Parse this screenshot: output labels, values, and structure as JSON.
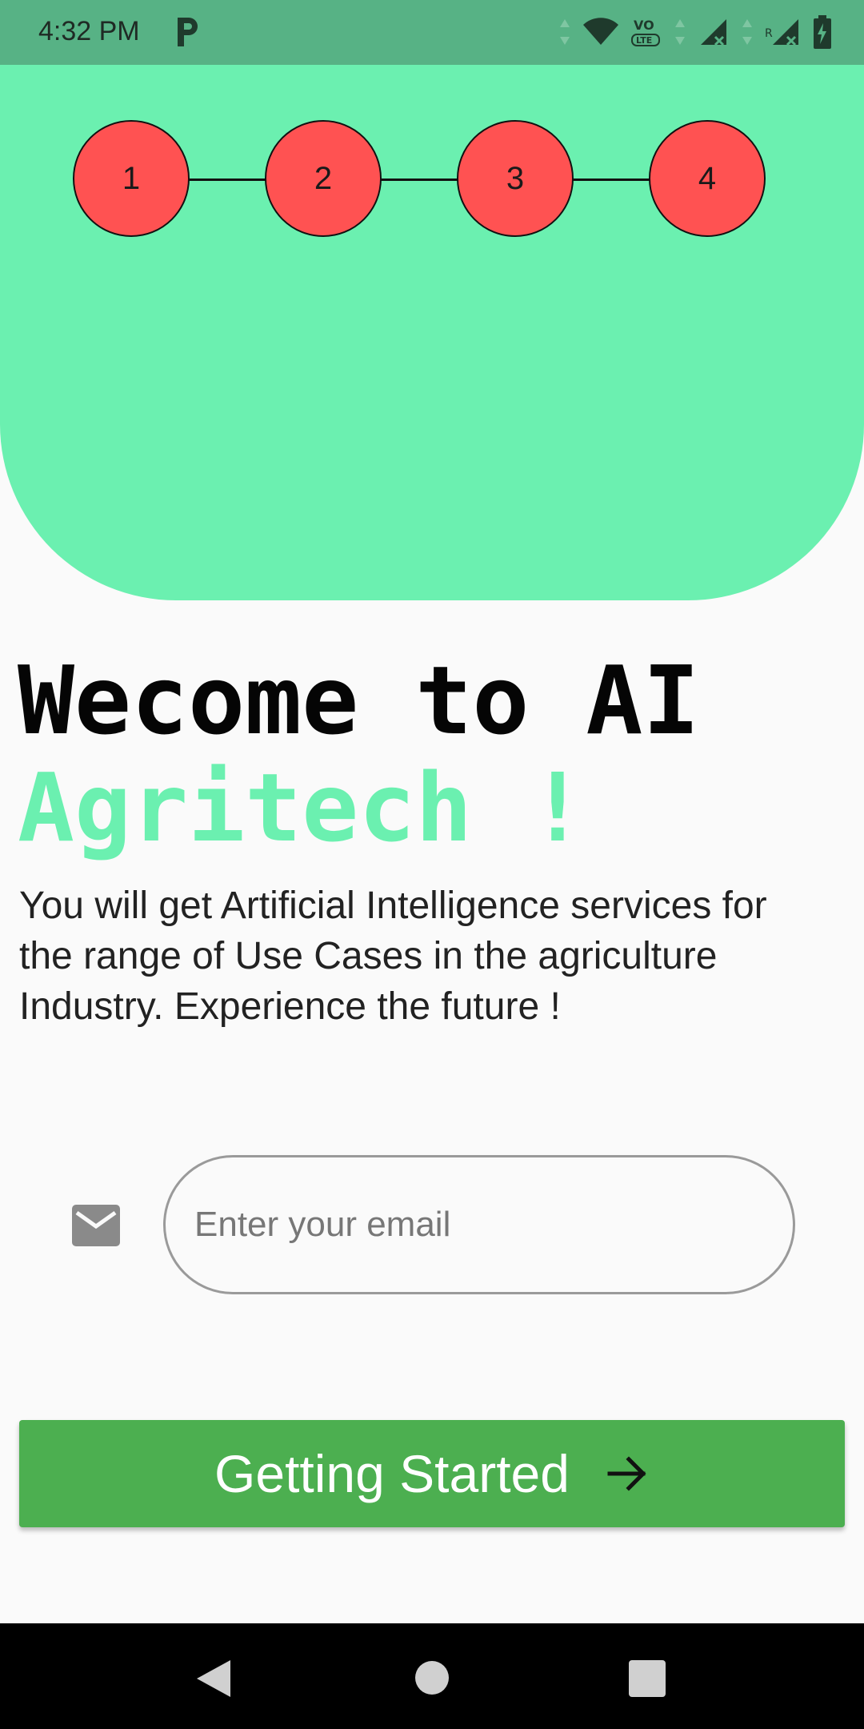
{
  "status_bar": {
    "time": "4:32 PM",
    "app_icon": "parking-p-icon",
    "icons": [
      "data-arrows-icon",
      "wifi-icon",
      "volte-icon",
      "signal-x-icon",
      "signal-roaming-x-icon",
      "battery-charging-icon"
    ],
    "color": "#57b285"
  },
  "stepper": {
    "steps": [
      "1",
      "2",
      "3",
      "4"
    ],
    "step_color": "#ff5252"
  },
  "header": {
    "color": "#6bf0b0"
  },
  "title": {
    "line1": "Wecome to AI",
    "line2": "Agritech !",
    "accent_color": "#6bf0b0"
  },
  "description": "You will get Artificial Intelligence services for the range of Use Cases in the agriculture Industry. Experience the future !",
  "email": {
    "icon": "mail-icon",
    "placeholder": "Enter your email",
    "value": ""
  },
  "start_button": {
    "label": "Getting Started",
    "icon": "arrow-right-icon",
    "color": "#4caf50"
  },
  "nav_bar": {
    "icons": [
      "back-icon",
      "home-icon",
      "recents-icon"
    ]
  }
}
